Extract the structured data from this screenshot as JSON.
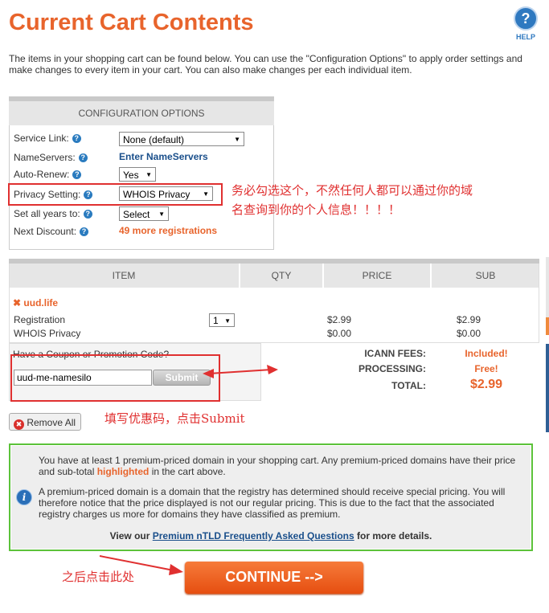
{
  "page": {
    "title": "Current Cart Contents",
    "help_label": "HELP",
    "intro": "The items in your shopping cart can be found below. You can use the \"Configuration Options\" to apply order settings and make changes to every item in your cart. You can also make changes per each individual item."
  },
  "config": {
    "heading": "CONFIGURATION OPTIONS",
    "service_link_label": "Service Link:",
    "service_link_value": "None (default)",
    "nameservers_label": "NameServers:",
    "nameservers_link": "Enter NameServers",
    "auto_renew_label": "Auto-Renew:",
    "auto_renew_value": "Yes",
    "privacy_label": "Privacy Setting:",
    "privacy_value": "WHOIS Privacy",
    "set_years_label": "Set all years to:",
    "set_years_value": "Select",
    "next_discount_label": "Next Discount:",
    "next_discount_value": "49 more registrations"
  },
  "cart": {
    "headers": [
      "ITEM",
      "QTY",
      "PRICE",
      "SUB"
    ],
    "domain": "uud.life",
    "rows": [
      {
        "item": "Registration",
        "qty": "1",
        "price": "$2.99",
        "sub": "$2.99"
      },
      {
        "item": "WHOIS Privacy",
        "price": "$0.00",
        "sub": "$0.00"
      }
    ],
    "icann_label": "ICANN FEES:",
    "icann_value": "Included!",
    "processing_label": "PROCESSING:",
    "processing_value": "Free!",
    "total_label": "TOTAL:",
    "total_value": "$2.99"
  },
  "coupon": {
    "label": "Have a Coupon or Promotion Code?",
    "value": "uud-me-namesilo",
    "submit_label": "Submit"
  },
  "remove_all_label": "Remove All",
  "notice": {
    "p1_a": "You have at least 1 premium-priced domain in your shopping cart. Any premium-priced domains have their price and sub-total ",
    "p1_highlight": "highlighted",
    "p1_b": " in the cart above.",
    "p2": "A premium-priced domain is a domain that the registry has determined should receive special pricing. You will therefore notice that the price displayed is not our regular pricing. This is due to the fact that the associated registry charges us more for domains they have classified as premium.",
    "p3_a": "View our ",
    "p3_link": "Premium nTLD Frequently Asked Questions",
    "p3_b": " for more details."
  },
  "continue_label": "CONTINUE -->",
  "annotations": {
    "privacy_note_line1": "务必勾选这个，不然任何人都可以通过你的域",
    "privacy_note_line2": "名查询到你的个人信息！！！！",
    "coupon_note": "填写优惠码，点击Submit",
    "continue_note": "之后点击此处"
  },
  "colors": {
    "title_orange": "#e8642c",
    "annotation_red": "#e03030",
    "notice_border_green": "#5cc23a",
    "link_blue": "#1a4f8b"
  }
}
